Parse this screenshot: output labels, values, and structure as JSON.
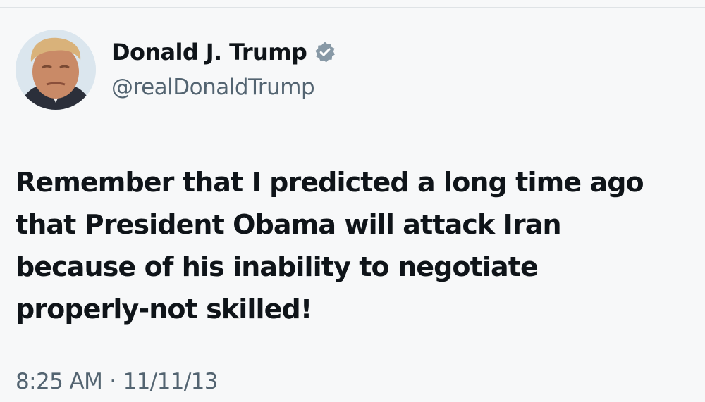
{
  "tweet": {
    "author": {
      "display_name": "Donald J. Trump",
      "handle": "@realDonaldTrump",
      "verified": true,
      "avatar_icon": "profile-photo",
      "verified_icon": "verified-badge-icon",
      "verified_color": "#8899a6"
    },
    "text_lines": [
      "Remember that I predicted a long time ago",
      "that President Obama will attack Iran",
      "because of his inability to negotiate",
      "properly-not skilled!"
    ],
    "time": "8:25 AM",
    "separator": "·",
    "date": "11/11/13"
  },
  "colors": {
    "text": "#0f1419",
    "secondary": "#536471",
    "background": "#f7f8f9"
  }
}
